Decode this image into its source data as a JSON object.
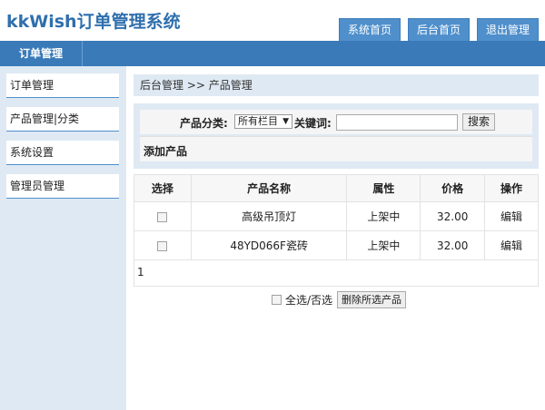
{
  "app": {
    "title": "kkWish订单管理系统"
  },
  "topnav": {
    "items": [
      "系统首页",
      "后台首页",
      "退出管理"
    ]
  },
  "module": {
    "label": "订单管理"
  },
  "sidebar": {
    "items": [
      "订单管理",
      "产品管理|分类",
      "系统设置",
      "管理员管理"
    ]
  },
  "breadcrumb": "后台管理 >> 产品管理",
  "filter": {
    "category_label": "产品分类:",
    "category_value": "所有栏目",
    "keyword_label": "关键词:",
    "keyword_value": "",
    "search_label": "搜索",
    "add_product_label": "添加产品"
  },
  "table": {
    "headers": [
      "选择",
      "产品名称",
      "属性",
      "价格",
      "操作"
    ],
    "rows": [
      {
        "name": "高级吊顶灯",
        "status": "上架中",
        "price": "32.00",
        "action": "编辑"
      },
      {
        "name": "48YD066F瓷砖",
        "status": "上架中",
        "price": "32.00",
        "action": "编辑"
      }
    ]
  },
  "pager": {
    "page": "1"
  },
  "bulk": {
    "select_all_label": "全选/否选",
    "delete_label": "删除所选产品"
  },
  "colors": {
    "accent": "#3a7ab8",
    "tab_blue": "#4f8fcb",
    "panel_bg": "#dfe9f3",
    "logo": "#2f6fad"
  }
}
